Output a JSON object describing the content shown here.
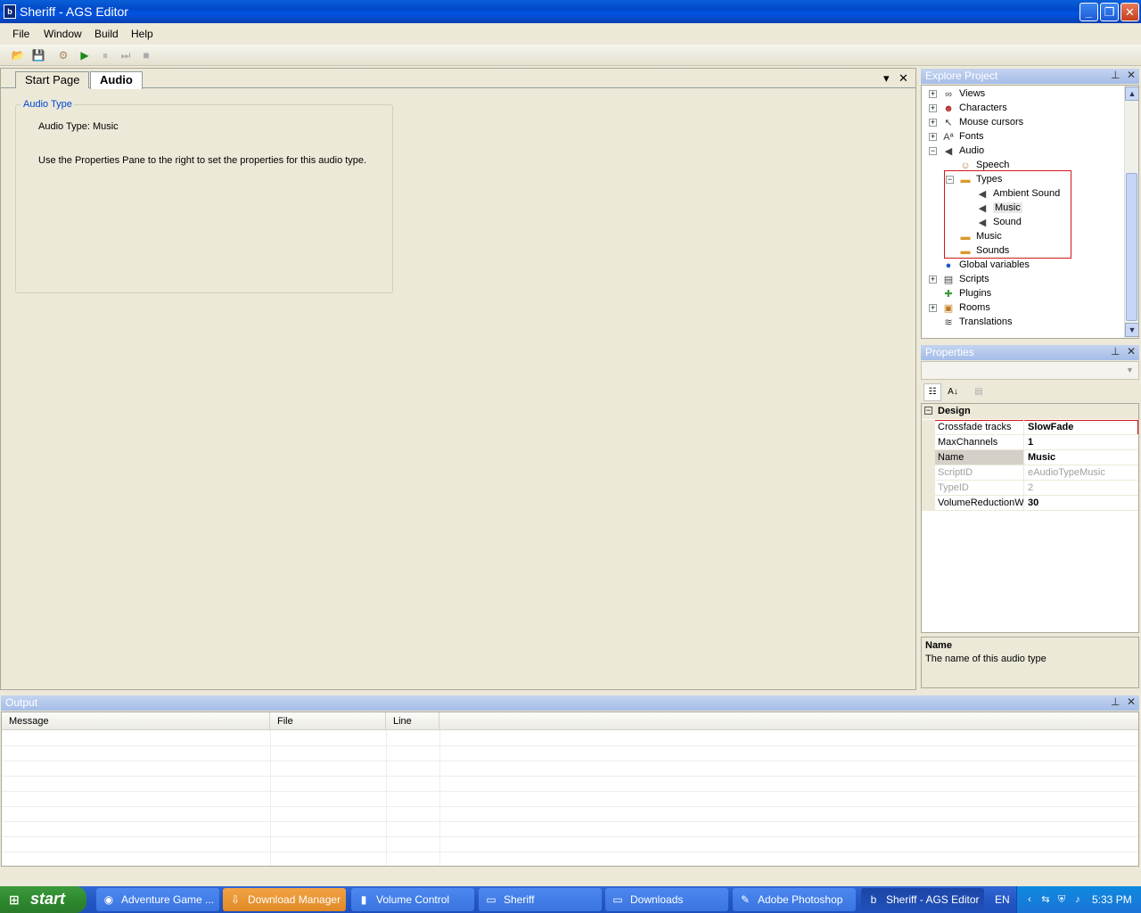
{
  "window": {
    "app_icon": "ags-icon",
    "title": "Sheriff - AGS Editor",
    "minimize": "minimize-icon",
    "restore": "restore-icon",
    "close": "close-icon"
  },
  "menu": [
    "File",
    "Window",
    "Build",
    "Help"
  ],
  "toolbar": {
    "icons": [
      "open-icon",
      "save-icon",
      "build-icon",
      "run-icon",
      "pause-icon",
      "step-icon",
      "stop-icon"
    ]
  },
  "doc": {
    "tabs": [
      "Start Page",
      "Audio"
    ],
    "active_tab": "Audio",
    "group_title": "Audio Type",
    "line1": "Audio Type: Music",
    "line2": "Use the Properties Pane to the right to set the properties for this audio type."
  },
  "explore": {
    "title": "Explore Project",
    "items": [
      {
        "label": "Views",
        "icon": "views-icon",
        "expander": "+"
      },
      {
        "label": "Characters",
        "icon": "characters-icon",
        "expander": "+"
      },
      {
        "label": "Mouse cursors",
        "icon": "cursor-icon",
        "expander": "+"
      },
      {
        "label": "Fonts",
        "icon": "font-icon",
        "expander": "+"
      },
      {
        "label": "Audio",
        "icon": "speaker-icon",
        "expander": "−"
      },
      {
        "label": "Speech",
        "icon": "speech-icon",
        "expander": ""
      },
      {
        "label": "Types",
        "icon": "folder-icon",
        "expander": "−"
      },
      {
        "label": "Ambient Sound",
        "icon": "speaker-icon",
        "expander": ""
      },
      {
        "label": "Music",
        "icon": "speaker-icon",
        "expander": ""
      },
      {
        "label": "Sound",
        "icon": "speaker-icon",
        "expander": ""
      },
      {
        "label": "Music",
        "icon": "folder-icon",
        "expander": ""
      },
      {
        "label": "Sounds",
        "icon": "folder-icon",
        "expander": ""
      },
      {
        "label": "Global variables",
        "icon": "globe-icon",
        "expander": ""
      },
      {
        "label": "Scripts",
        "icon": "scripts-icon",
        "expander": "+"
      },
      {
        "label": "Plugins",
        "icon": "plugin-icon",
        "expander": ""
      },
      {
        "label": "Rooms",
        "icon": "rooms-icon",
        "expander": "+"
      },
      {
        "label": "Translations",
        "icon": "translation-icon",
        "expander": ""
      }
    ]
  },
  "properties": {
    "title": "Properties",
    "category": "Design",
    "rows": [
      {
        "name": "Crossfade tracks",
        "value": "SlowFade"
      },
      {
        "name": "MaxChannels",
        "value": "1"
      },
      {
        "name": "Name",
        "value": "Music"
      },
      {
        "name": "ScriptID",
        "value": "eAudioTypeMusic"
      },
      {
        "name": "TypeID",
        "value": "2"
      },
      {
        "name": "VolumeReductionWh",
        "value": "30"
      }
    ],
    "desc_title": "Name",
    "desc_text": "The name of this audio type"
  },
  "output": {
    "title": "Output",
    "columns": [
      "Message",
      "File",
      "Line"
    ]
  },
  "panel_icons": {
    "pin": "pin-icon",
    "close": "close-icon"
  },
  "taskbar": {
    "start": "start",
    "tasks": [
      {
        "label": "Adventure Game ...",
        "icon": "browser-icon"
      },
      {
        "label": "Download Manager",
        "icon": "download-icon"
      },
      {
        "label": "Volume Control",
        "icon": "volume-icon"
      },
      {
        "label": "Sheriff",
        "icon": "folder-icon"
      },
      {
        "label": "Downloads",
        "icon": "folder-icon"
      },
      {
        "label": "Adobe Photoshop",
        "icon": "photoshop-icon"
      },
      {
        "label": "Sheriff - AGS Editor",
        "icon": "ags-icon"
      }
    ],
    "lang": "EN",
    "clock": "5:33 PM"
  }
}
